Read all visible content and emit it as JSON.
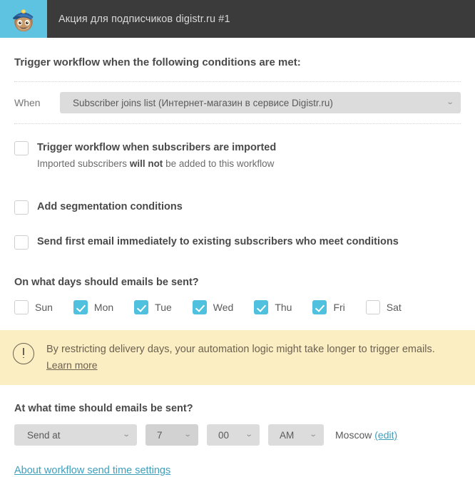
{
  "header": {
    "logo_alt": "mailchimp-freddie-logo",
    "title": "Акция для подписчиков digistr.ru #1"
  },
  "trigger": {
    "heading": "Trigger workflow when the following conditions are met:",
    "when_label": "When",
    "when_value": "Subscriber joins list (Интернет-магазин в сервисе Digistr.ru)"
  },
  "options": [
    {
      "label": "Trigger workflow when subscribers are imported",
      "sub_prefix": "Imported subscribers ",
      "sub_bold": "will not",
      "sub_suffix": " be added to this workflow",
      "checked": false
    },
    {
      "label": "Add segmentation conditions",
      "checked": false
    },
    {
      "label": "Send first email immediately to existing subscribers who meet conditions",
      "checked": false
    }
  ],
  "days": {
    "heading": "On what days should emails be sent?",
    "items": [
      {
        "label": "Sun",
        "checked": false
      },
      {
        "label": "Mon",
        "checked": true
      },
      {
        "label": "Tue",
        "checked": true
      },
      {
        "label": "Wed",
        "checked": true
      },
      {
        "label": "Thu",
        "checked": true
      },
      {
        "label": "Fri",
        "checked": true
      },
      {
        "label": "Sat",
        "checked": false
      }
    ]
  },
  "warning": {
    "icon": "exclamation-circle-icon",
    "text": "By restricting delivery days, your automation logic might take longer to trigger emails.",
    "link": "Learn more",
    "bg_color": "#fceec3",
    "text_color": "#6b6250"
  },
  "time": {
    "heading": "At what time should emails be sent?",
    "mode": "Send at",
    "hour": "7",
    "minute": "00",
    "meridiem": "AM",
    "timezone": "Moscow",
    "edit_label": "(edit)"
  },
  "footer": {
    "link": "About workflow send time settings"
  },
  "colors": {
    "accent": "#4fc0dd",
    "link": "#3e9fbd",
    "header_bg": "#3b3b3b",
    "logo_bg": "#5ec3e0",
    "select_bg": "#dcdcdc",
    "select_bg_hover": "#d2d2d2"
  },
  "icons": {
    "caret": "⌄"
  }
}
